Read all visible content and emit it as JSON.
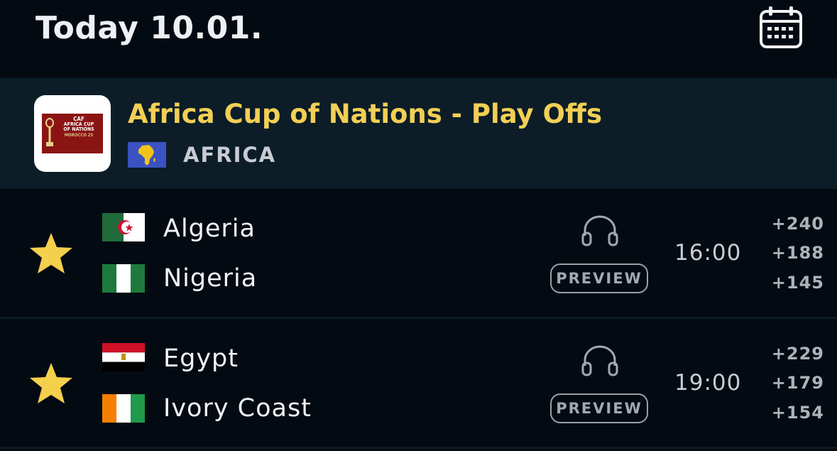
{
  "header": {
    "title": "Today 10.01.",
    "calendar_icon": "calendar-icon"
  },
  "league": {
    "name": "Africa Cup of Nations - Play Offs",
    "region": "AFRICA",
    "logo": {
      "line1": "CAF",
      "line2": "AFRICA CUP",
      "line3": "OF NATIONS",
      "line4": "MOROCCO 25"
    }
  },
  "matches": [
    {
      "home": "Algeria",
      "away": "Nigeria",
      "time": "16:00",
      "preview_label": "PREVIEW",
      "odds": [
        "+240",
        "+188",
        "+145"
      ],
      "favorite": true
    },
    {
      "home": "Egypt",
      "away": "Ivory Coast",
      "time": "19:00",
      "preview_label": "PREVIEW",
      "odds": [
        "+229",
        "+179",
        "+154"
      ],
      "favorite": true
    }
  ],
  "colors": {
    "background": "#040a12",
    "league_band": "#0c1d28",
    "accent_gold": "#f2cf55",
    "star": "#f5d04c"
  }
}
